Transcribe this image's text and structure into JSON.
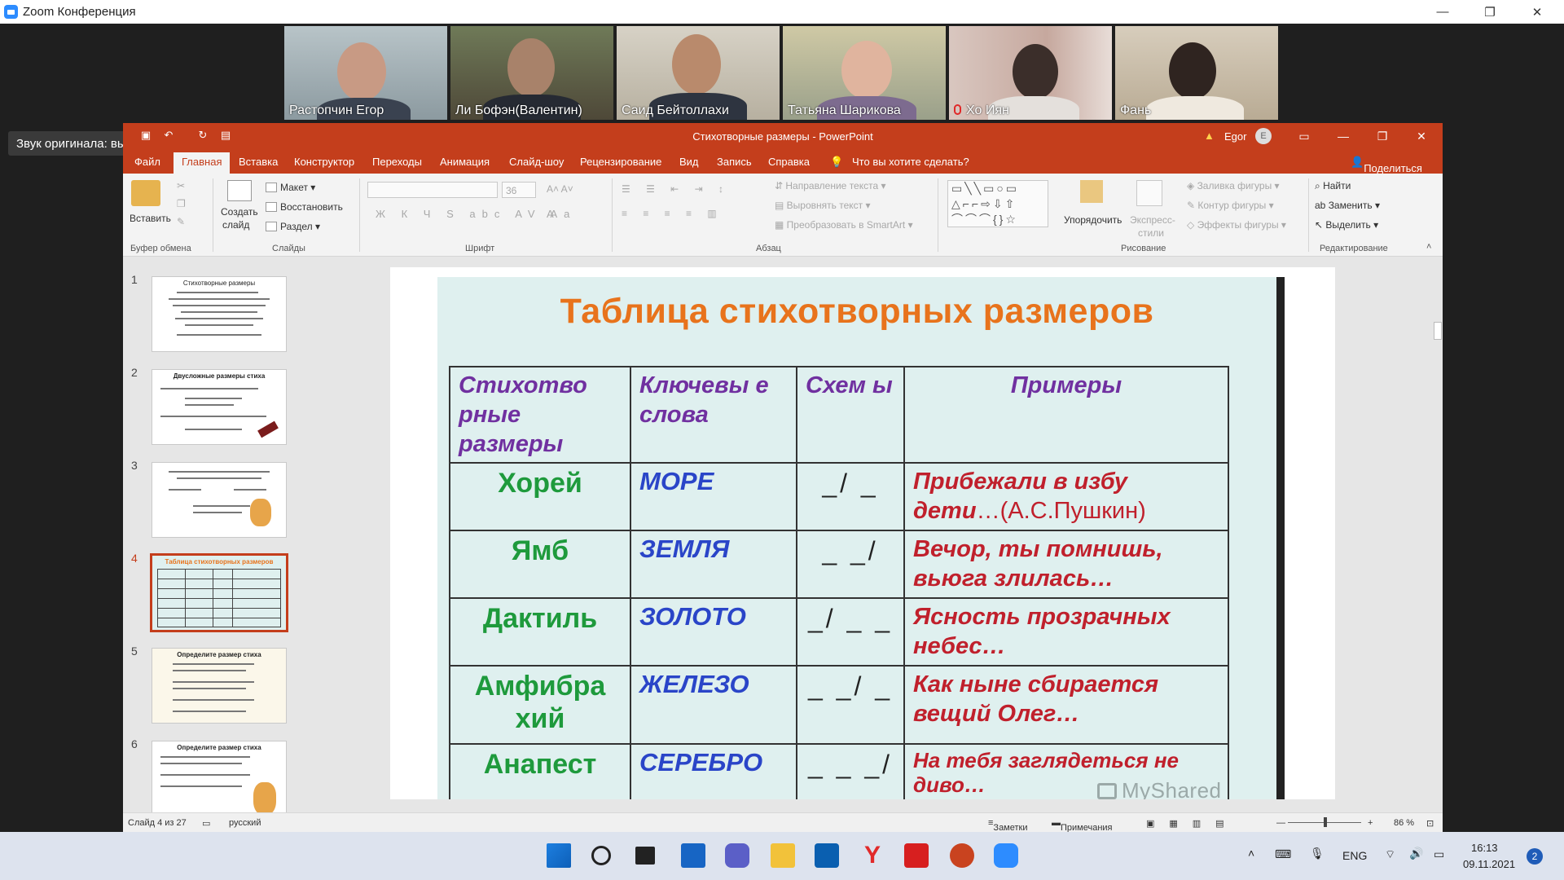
{
  "zoom": {
    "title": "Zoom Конференция",
    "minimize": "—",
    "restore": "❐",
    "close": "✕"
  },
  "participants": [
    {
      "name": "Растопчин Егор",
      "muted": false
    },
    {
      "name": "Ли Бофэн(Валентин)",
      "muted": false
    },
    {
      "name": "Саид Бейтоллахи",
      "muted": false
    },
    {
      "name": "Татьяна Шарикова",
      "muted": false
    },
    {
      "name": "Хо Иян",
      "muted": true
    },
    {
      "name": "Фань",
      "muted": false
    }
  ],
  "original_sound": {
    "label": "Звук оригинала: выкл."
  },
  "ppt": {
    "title": "Стихотворные размеры  -  PowerPoint",
    "user": "Egor",
    "user_initial": "E",
    "share": "Поделиться",
    "tabs": [
      "Файл",
      "Главная",
      "Вставка",
      "Конструктор",
      "Переходы",
      "Анимация",
      "Слайд-шоу",
      "Рецензирование",
      "Вид",
      "Запись",
      "Справка"
    ],
    "tell_me": "Что вы хотите сделать?",
    "ribbon": {
      "paste": "Вставить",
      "clipboard": "Буфер обмена",
      "new_slide_1": "Создать",
      "new_slide_2": "слайд",
      "layout": "Макет",
      "reset": "Восстановить",
      "section": "Раздел",
      "slides": "Слайды",
      "font_size": "36",
      "font": "Шрифт",
      "text_direction": "Направление текста",
      "align_text": "Выровнять текст",
      "smartart": "Преобразовать в SmartArt",
      "paragraph": "Абзац",
      "arrange": "Упорядочить",
      "quick_styles_1": "Экспресс-",
      "quick_styles_2": "стили",
      "shape_fill": "Заливка фигуры",
      "shape_outline": "Контур фигуры",
      "shape_effects": "Эффекты фигуры",
      "drawing": "Рисование",
      "find": "Найти",
      "replace": "Заменить",
      "select": "Выделить",
      "editing": "Редактирование"
    },
    "slide_numbers": [
      "1",
      "2",
      "3",
      "4",
      "5",
      "6"
    ],
    "selected_slide": 4,
    "thumb_titles": {
      "t1": "Стихотворные размеры",
      "t2": "Двусложные размеры стиха",
      "t4": "Таблица стихотворных размеров",
      "t5": "Определите размер стиха",
      "t6": "Определите размер стиха"
    },
    "status": {
      "slide_of": "Слайд 4 из 27",
      "language": "русский",
      "notes": "Заметки",
      "comments": "Примечания",
      "zoom": "86 %"
    }
  },
  "slide": {
    "title": "Таблица стихотворных размеров",
    "headers": [
      "Стихотво рные размеры",
      "Ключевы е слова",
      "Схем ы",
      "Примеры"
    ],
    "rows": [
      {
        "meter": "Хорей",
        "word": "МОРЕ",
        "scheme": "_/ _",
        "example": "Прибежали в избу дети",
        "example_suffix": "…(А.С.Пушкин)"
      },
      {
        "meter": "Ямб",
        "word": "ЗЕМЛЯ",
        "scheme": "_ _/",
        "example": "Вечор, ты помнишь, вьюга злилась…",
        "example_suffix": ""
      },
      {
        "meter": "Дактиль",
        "word": "ЗОЛОТО",
        "scheme": "_/ _ _",
        "example": "Ясность прозрачных небес…",
        "example_suffix": ""
      },
      {
        "meter": "Амфибра хий",
        "word": "ЖЕЛЕЗО",
        "scheme": "_ _/ _",
        "example": "Как ныне сбирается вещий Олег…",
        "example_suffix": ""
      },
      {
        "meter": "Анапест",
        "word": "СЕРЕБРО",
        "scheme": "_ _ _/",
        "example": "На тебя заглядеться не диво…",
        "example_suffix": ""
      }
    ],
    "watermark": "MyShared"
  },
  "taskbar": {
    "language": "ENG",
    "time": "16:13",
    "date": "09.11.2021",
    "notifications": "2"
  }
}
